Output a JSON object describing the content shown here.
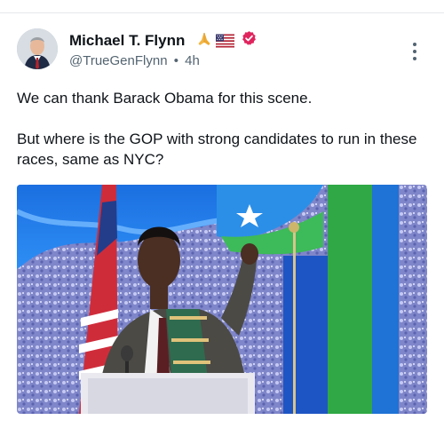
{
  "post": {
    "author_name": "Michael T. Flynn",
    "name_emojis": [
      "praying-hands-emoji",
      "us-flag-emoji",
      "verified-badge-icon"
    ],
    "handle": "@TrueGenFlynn",
    "separator": "•",
    "time": "4h",
    "text_paragraph_1": "We can thank Barack Obama for this scene.",
    "text_paragraph_2": "But where is the GOP with strong candidates to run in these races, same as NYC?",
    "colors": {
      "verified": "#e0245e",
      "secondary_text": "#536471"
    }
  }
}
